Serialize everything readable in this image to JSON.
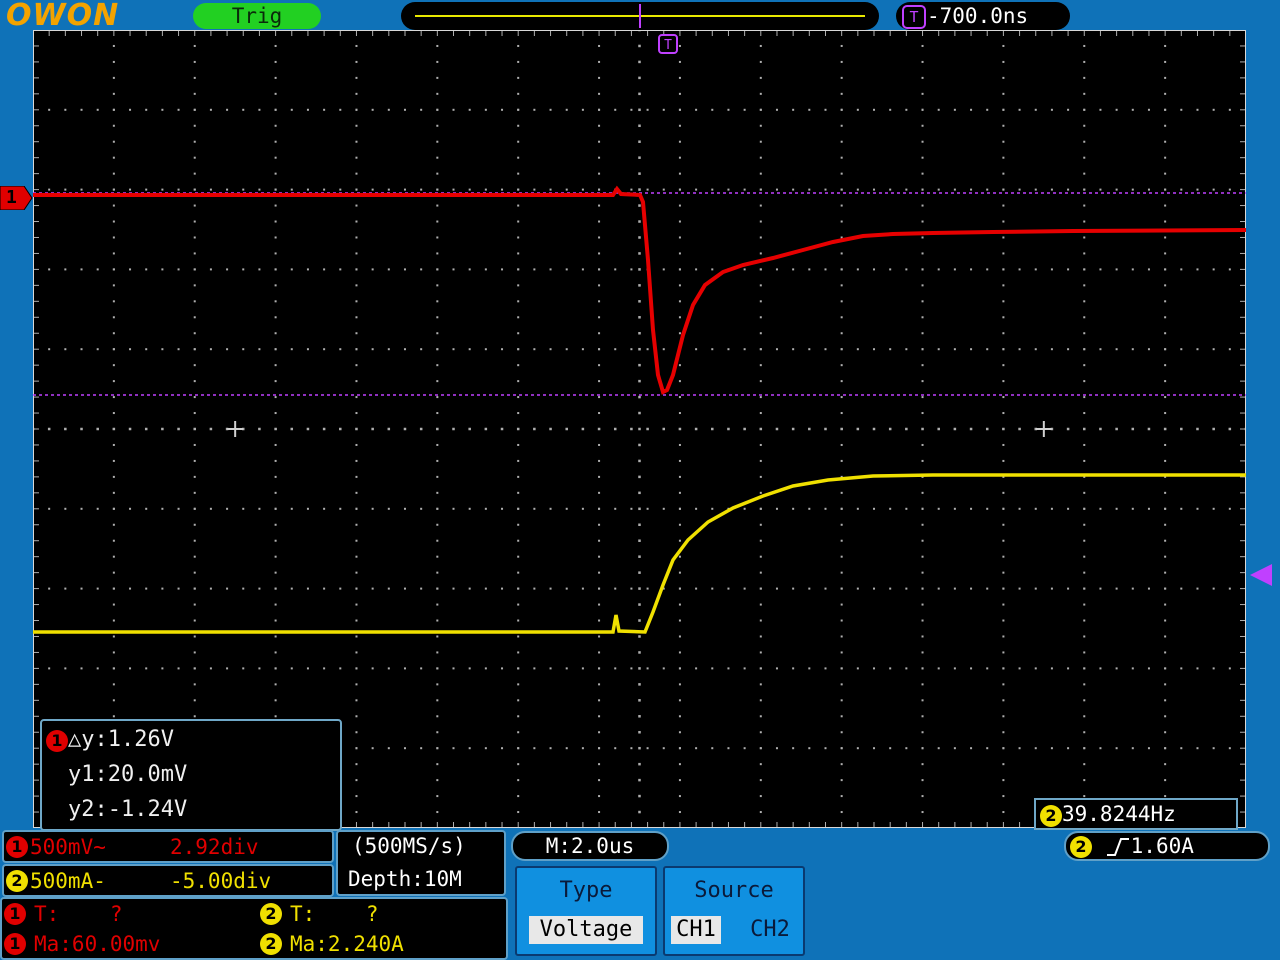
{
  "header": {
    "logo": "OWON",
    "trig_status": "Trig",
    "trigger_offset": "-700.0ns",
    "trigger_badge": "T"
  },
  "screen": {
    "ch1_marker": "1",
    "trigger_marker": "T"
  },
  "cursor": {
    "channel": "1",
    "delta_y": "△y:1.26V",
    "y1": "y1:20.0mV",
    "y2": "y2:-1.24V"
  },
  "frequency": {
    "channel": "2",
    "value": "39.8244Hz"
  },
  "channels": [
    {
      "num": "1",
      "scale": "500mV~",
      "offset": "2.92div"
    },
    {
      "num": "2",
      "scale": "500mA-",
      "offset": "-5.00div"
    }
  ],
  "acquisition": {
    "sample_rate": "(500MS/s)",
    "depth": "Depth:10M"
  },
  "timebase": "M:2.0us",
  "trigger": {
    "channel": "2",
    "level": "1.60A"
  },
  "measurements": {
    "ch1_period": "T:    ?",
    "ch2_period": "T:    ?",
    "ch1_mean": "Ma:60.00mv",
    "ch2_mean": "Ma:2.240A"
  },
  "menu": {
    "type_title": "Type",
    "type_value": "Voltage",
    "source_title": "Source",
    "source_ch1": "CH1",
    "source_ch2": "CH2"
  },
  "colors": {
    "ch1": "#e00000",
    "ch2": "#f0e000",
    "cursor": "#c040ff",
    "background": "#0f72b8"
  }
}
